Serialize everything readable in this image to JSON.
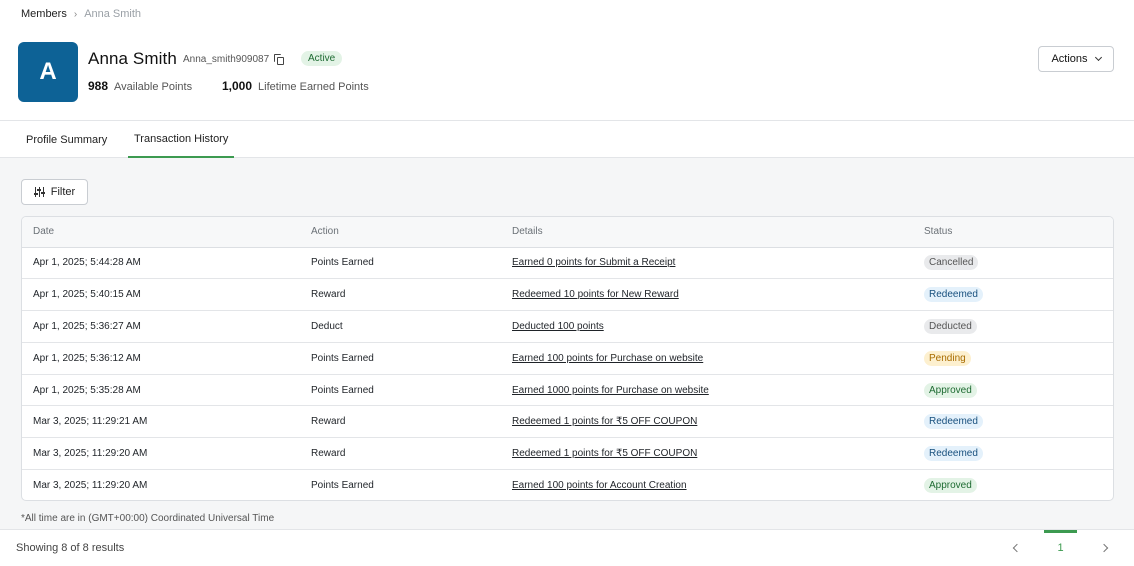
{
  "breadcrumb": {
    "parent": "Members",
    "current": "Anna Smith"
  },
  "member": {
    "initial": "A",
    "name": "Anna Smith",
    "username": "Anna_smith909087",
    "status": "Active",
    "available_points": "988",
    "available_points_label": "Available Points",
    "lifetime_points": "1,000",
    "lifetime_points_label": "Lifetime Earned Points",
    "avatar_color": "#0d6296"
  },
  "actions_label": "Actions",
  "tabs": [
    {
      "label": "Profile Summary",
      "active": false
    },
    {
      "label": "Transaction History",
      "active": true
    }
  ],
  "filter_label": "Filter",
  "table": {
    "headers": [
      "Date",
      "Action",
      "Details",
      "Status"
    ],
    "rows": [
      {
        "date": "Apr 1, 2025; 5:44:28 AM",
        "action": "Points Earned",
        "details": "Earned 0 points for Submit a Receipt",
        "status": "Cancelled"
      },
      {
        "date": "Apr 1, 2025; 5:40:15 AM",
        "action": "Reward",
        "details": "Redeemed 10 points for New Reward",
        "status": "Redeemed"
      },
      {
        "date": "Apr 1, 2025; 5:36:27 AM",
        "action": "Deduct",
        "details": "Deducted 100 points",
        "status": "Deducted"
      },
      {
        "date": "Apr 1, 2025; 5:36:12 AM",
        "action": "Points Earned",
        "details": "Earned 100 points for Purchase on website",
        "status": "Pending"
      },
      {
        "date": "Apr 1, 2025; 5:35:28 AM",
        "action": "Points Earned",
        "details": "Earned 1000 points for Purchase on website",
        "status": "Approved"
      },
      {
        "date": "Mar 3, 2025; 11:29:21 AM",
        "action": "Reward",
        "details": "Redeemed 1 points for ₹5 OFF COUPON",
        "status": "Redeemed"
      },
      {
        "date": "Mar 3, 2025; 11:29:20 AM",
        "action": "Reward",
        "details": "Redeemed 1 points for ₹5 OFF COUPON",
        "status": "Redeemed"
      },
      {
        "date": "Mar 3, 2025; 11:29:20 AM",
        "action": "Points Earned",
        "details": "Earned 100 points for Account Creation",
        "status": "Approved"
      }
    ]
  },
  "footnote": "*All time are in (GMT+00:00) Coordinated Universal Time",
  "pagination": {
    "summary": "Showing 8 of 8 results",
    "current_page": "1"
  },
  "colors": {
    "accent": "#3c9a50",
    "avatar": "#0d6296"
  }
}
